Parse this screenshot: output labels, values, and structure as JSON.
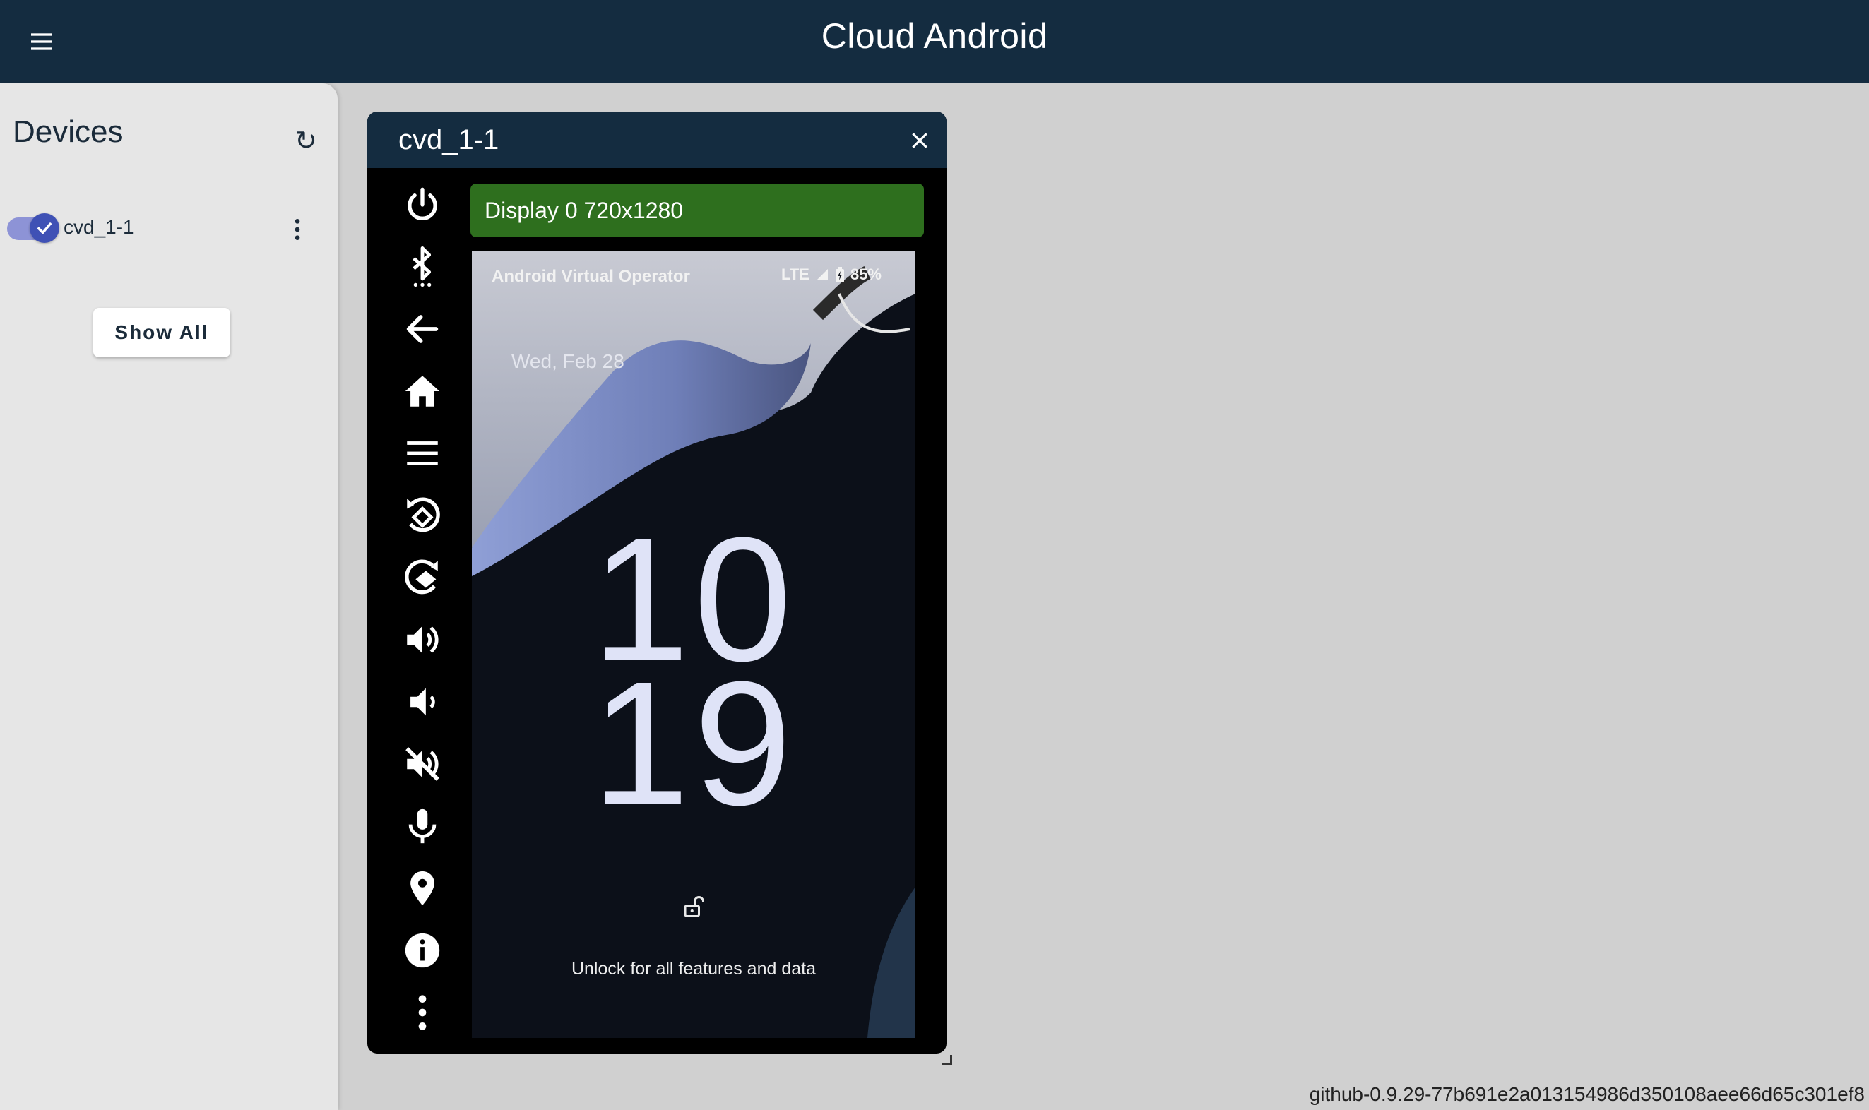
{
  "app": {
    "title": "Cloud Android",
    "menu_icon": "hamburger-menu-icon"
  },
  "sidebar": {
    "title": "Devices",
    "refresh_icon": "refresh-icon",
    "refresh_glyph": "↻",
    "devices": [
      {
        "name": "cvd_1-1",
        "selected": true
      }
    ],
    "show_all_label": "Show All"
  },
  "device_window": {
    "title": "cvd_1-1",
    "close_glyph": "×",
    "display_label": "Display 0 720x1280",
    "controls": [
      "power-icon",
      "bluetooth-icon",
      "back-icon",
      "home-icon",
      "menu-icon",
      "rotate-left-icon",
      "rotate-right-icon",
      "volume-up-icon",
      "volume-down-icon",
      "volume-mute-icon",
      "microphone-icon",
      "location-icon",
      "info-icon",
      "more-options-icon"
    ]
  },
  "phone": {
    "carrier": "Android Virtual Operator",
    "network": "LTE",
    "battery": "85%",
    "date": "Wed, Feb 28",
    "clock_hours": "10",
    "clock_minutes": "19",
    "unlock_text": "Unlock for all features and data"
  },
  "footer": {
    "version": "github-0.9.29-77b691e2a013154986d350108aee66d65c301ef8"
  },
  "colors": {
    "topbar": "#142c40",
    "sidebar_bg": "#e6e6e6",
    "page_bg": "#d0d0d0",
    "display_bar": "#2e6f1e",
    "toggle_accent": "#3f51b5"
  }
}
